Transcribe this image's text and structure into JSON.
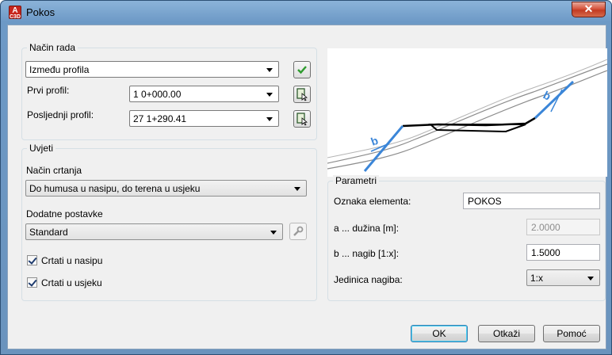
{
  "window": {
    "title": "Pokos",
    "app_icon_text": "A",
    "app_icon_sub": "C3D",
    "close_glyph": "✕"
  },
  "nacin_rada": {
    "group_title": "Način rada",
    "mode_value": "Između profila",
    "first_label": "Prvi profil:",
    "first_value": "1 0+000.00",
    "last_label": "Posljednji profil:",
    "last_value": "27 1+290.41"
  },
  "uvjeti": {
    "group_title": "Uvjeti",
    "draw_mode_label": "Način crtanja",
    "draw_mode_value": "Do humusa u nasipu, do terena u usjeku",
    "extra_label": "Dodatne postavke",
    "extra_value": "Standard",
    "cb_nasip_label": "Crtati u nasipu",
    "cb_nasip_checked": true,
    "cb_usjek_label": "Crtati u usjeku",
    "cb_usjek_checked": true
  },
  "parametri": {
    "group_title": "Parametri",
    "oznaka_label": "Oznaka elementa:",
    "oznaka_value": "POKOS",
    "a_label": "a ... dužina [m]:",
    "a_value": "2.0000",
    "b_label": "b ... nagib [1:x]:",
    "b_value": "1.5000",
    "jedinica_label": "Jedinica nagiba:",
    "jedinica_value": "1:x"
  },
  "preview": {
    "label_b": "b"
  },
  "buttons": {
    "ok": "OK",
    "cancel": "Otkaži",
    "help": "Pomoć"
  },
  "colors": {
    "accent_blue": "#3b86d8",
    "confirm_green": "#2e9b2e"
  }
}
